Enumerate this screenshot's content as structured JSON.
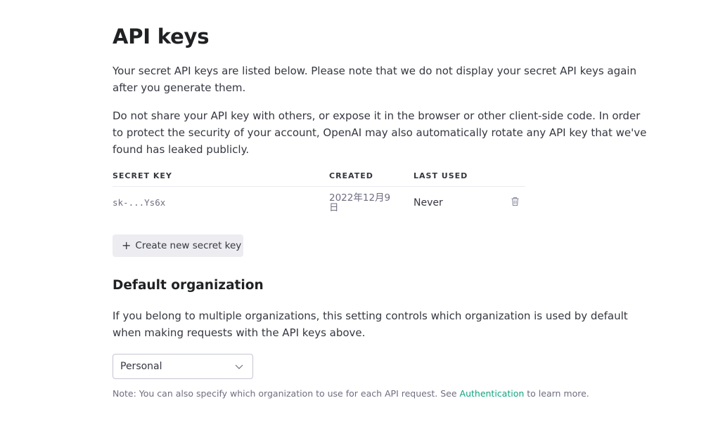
{
  "page": {
    "title": "API keys",
    "intro_1": "Your secret API keys are listed below. Please note that we do not display your secret API keys again after you generate them.",
    "intro_2": "Do not share your API key with others, or expose it in the browser or other client-side code. In order to protect the security of your account, OpenAI may also automatically rotate any API key that we've found has leaked publicly."
  },
  "keys_table": {
    "headers": {
      "secret_key": "SECRET KEY",
      "created": "CREATED",
      "last_used": "LAST USED"
    },
    "rows": [
      {
        "secret_key": "sk-...Ys6x",
        "created": "2022年12月9日",
        "last_used": "Never",
        "action_icon": "trash-icon"
      }
    ]
  },
  "create_button": {
    "icon": "plus-icon",
    "label": "Create new secret key"
  },
  "default_org": {
    "heading": "Default organization",
    "description": "If you belong to multiple organizations, this setting controls which organization is used by default when making requests with the API keys above.",
    "selected": "Personal",
    "note_prefix": "Note: You can also specify which organization to use for each API request. See ",
    "note_link": "Authentication",
    "note_suffix": " to learn more."
  },
  "colors": {
    "link": "#10a37f",
    "button_bg": "#ececf1",
    "text": "#353740"
  }
}
